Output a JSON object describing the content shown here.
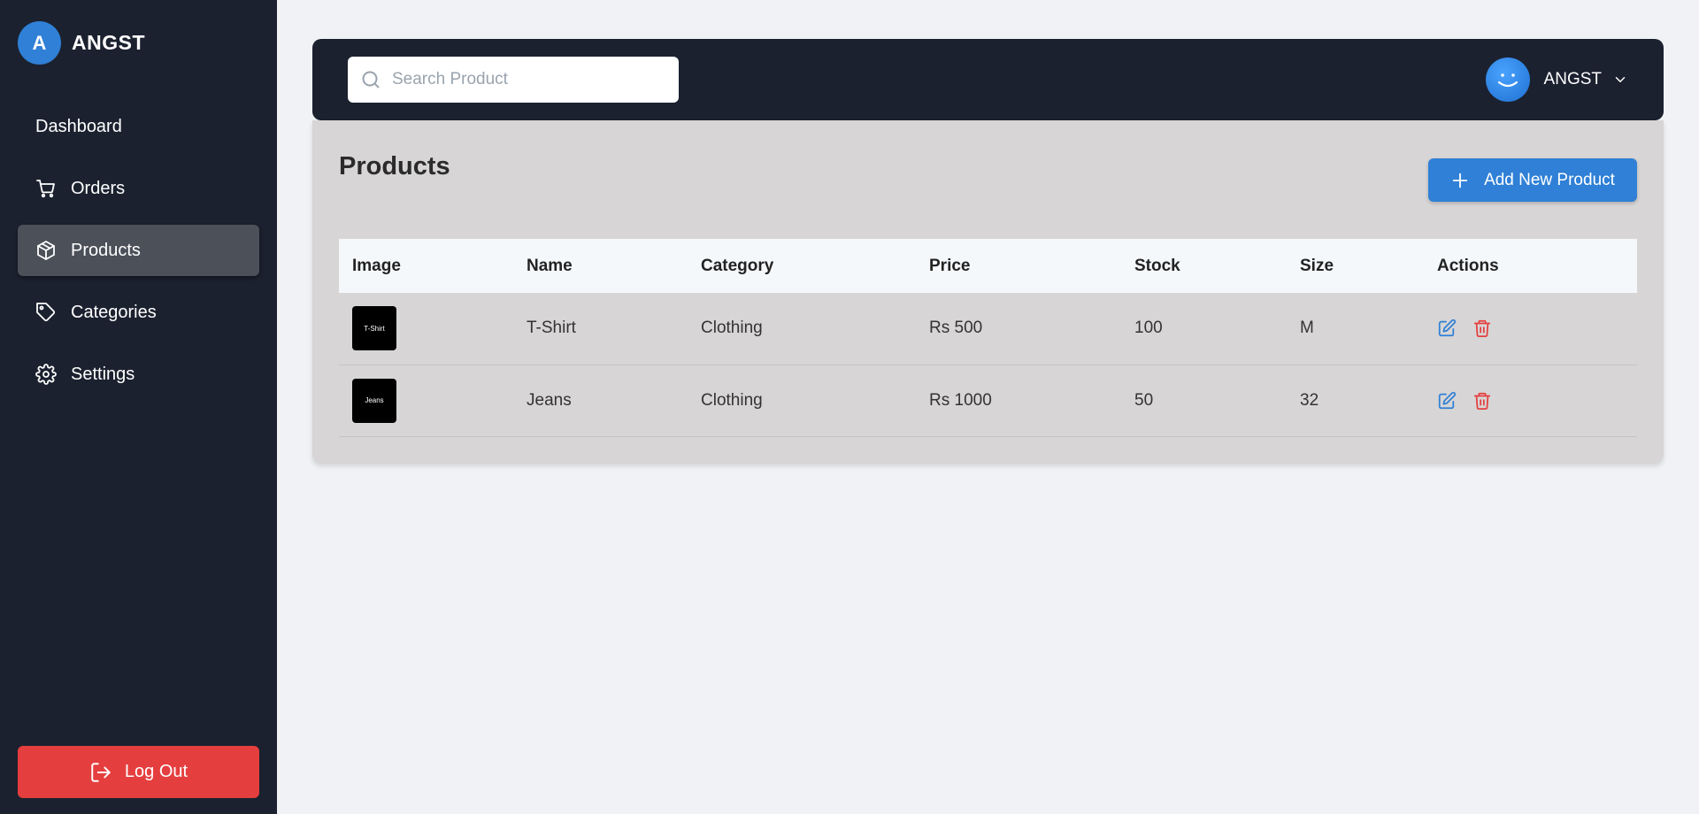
{
  "brand": {
    "initial": "A",
    "name": "ANGST"
  },
  "sidebar": {
    "items": [
      {
        "label": "Dashboard",
        "icon": "none"
      },
      {
        "label": "Orders",
        "icon": "cart-icon"
      },
      {
        "label": "Products",
        "icon": "box-icon",
        "active": true
      },
      {
        "label": "Categories",
        "icon": "tag-icon"
      },
      {
        "label": "Settings",
        "icon": "gear-icon"
      }
    ],
    "logout_label": "Log Out"
  },
  "header": {
    "search_placeholder": "Search Product",
    "search_value": "",
    "user_name": "ANGST"
  },
  "main": {
    "title": "Products",
    "add_button_label": "Add New Product",
    "table": {
      "columns": [
        "Image",
        "Name",
        "Category",
        "Price",
        "Stock",
        "Size",
        "Actions"
      ],
      "rows": [
        {
          "image_label": "T-Shirt",
          "name": "T-Shirt",
          "category": "Clothing",
          "price": "Rs 500",
          "stock": "100",
          "size": "M"
        },
        {
          "image_label": "Jeans",
          "name": "Jeans",
          "category": "Clothing",
          "price": "Rs 1000",
          "stock": "50",
          "size": "32"
        }
      ]
    }
  },
  "colors": {
    "sidebar_bg": "#1b212f",
    "accent": "#2f80d6",
    "danger": "#e53e3e",
    "card_bg": "#d7d5d5"
  }
}
